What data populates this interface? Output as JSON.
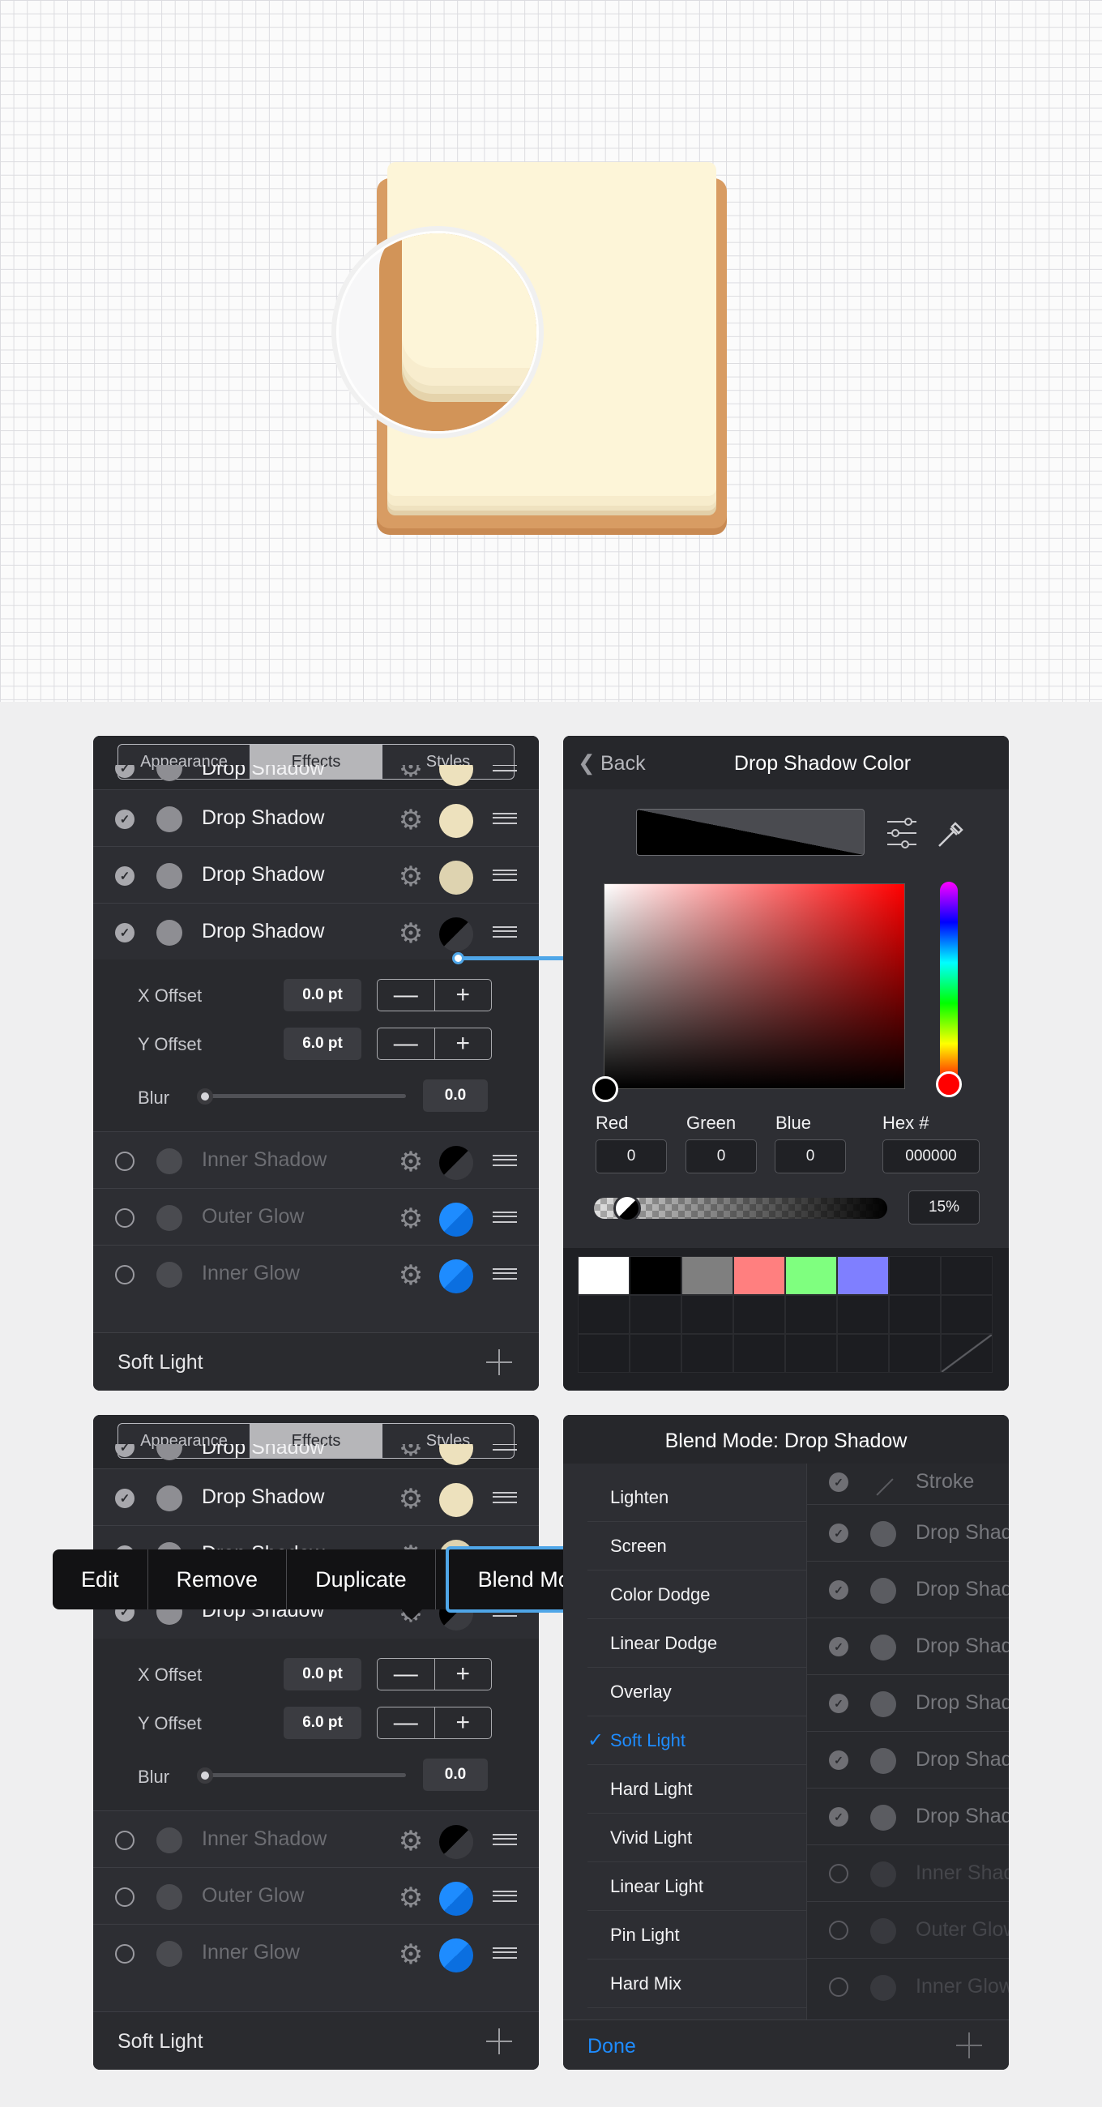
{
  "colors": {
    "accent": "#1e8cff",
    "panel": "#2d2e33",
    "paper": "#fdf5d8",
    "wood": "#d3955a"
  },
  "tabs": [
    "Appearance",
    "Effects",
    "Styles"
  ],
  "effects": [
    {
      "label": "Drop Shadow",
      "enabled": true,
      "swatch": "#ede1bd"
    },
    {
      "label": "Drop Shadow",
      "enabled": true,
      "swatch": "#ede1bd"
    },
    {
      "label": "Drop Shadow",
      "enabled": true,
      "swatch": "#ded3b0"
    },
    {
      "label": "Drop Shadow",
      "enabled": true,
      "swatch": "black-half"
    },
    {
      "label": "Inner Shadow",
      "enabled": false,
      "swatch": "black-half"
    },
    {
      "label": "Outer Glow",
      "enabled": false,
      "swatch": "#1e8cff"
    },
    {
      "label": "Inner Glow",
      "enabled": false,
      "swatch": "#1e8cff"
    }
  ],
  "offsets": {
    "x_label": "X Offset",
    "x_value": "0.0 pt",
    "y_label": "Y Offset",
    "y_value": "6.0 pt",
    "blur_label": "Blur",
    "blur_value": "0.0",
    "minus": "—",
    "plus": "+"
  },
  "bottom_label": "Soft Light",
  "color_panel": {
    "back": "Back",
    "title": "Drop Shadow Color",
    "red_label": "Red",
    "red": "0",
    "green_label": "Green",
    "green": "0",
    "blue_label": "Blue",
    "blue": "0",
    "hex_label": "Hex #",
    "hex": "000000",
    "opacity": "15%",
    "swatches": [
      "#ffffff",
      "#000000",
      "#7f7f7f",
      "#ff7f7f",
      "#7fff7f",
      "#7f7fff"
    ]
  },
  "context_menu": [
    "Edit",
    "Remove",
    "Duplicate",
    "Blend Mode"
  ],
  "blend_panel": {
    "title": "Blend Mode: Drop Shadow",
    "modes": [
      "Lighten",
      "Screen",
      "Color Dodge",
      "Linear Dodge",
      "Overlay",
      "Soft Light",
      "Hard Light",
      "Vivid Light",
      "Linear Light",
      "Pin Light",
      "Hard Mix"
    ],
    "selected": "Soft Light",
    "checkmark": "✓",
    "done": "Done",
    "behind": [
      "Stroke",
      "Drop Shadow",
      "Drop Shadow",
      "Drop Shadow",
      "Drop Shadow",
      "Drop Shadow",
      "Drop Shadow",
      "Inner Shadow",
      "Outer Glow",
      "Inner Glow"
    ]
  }
}
